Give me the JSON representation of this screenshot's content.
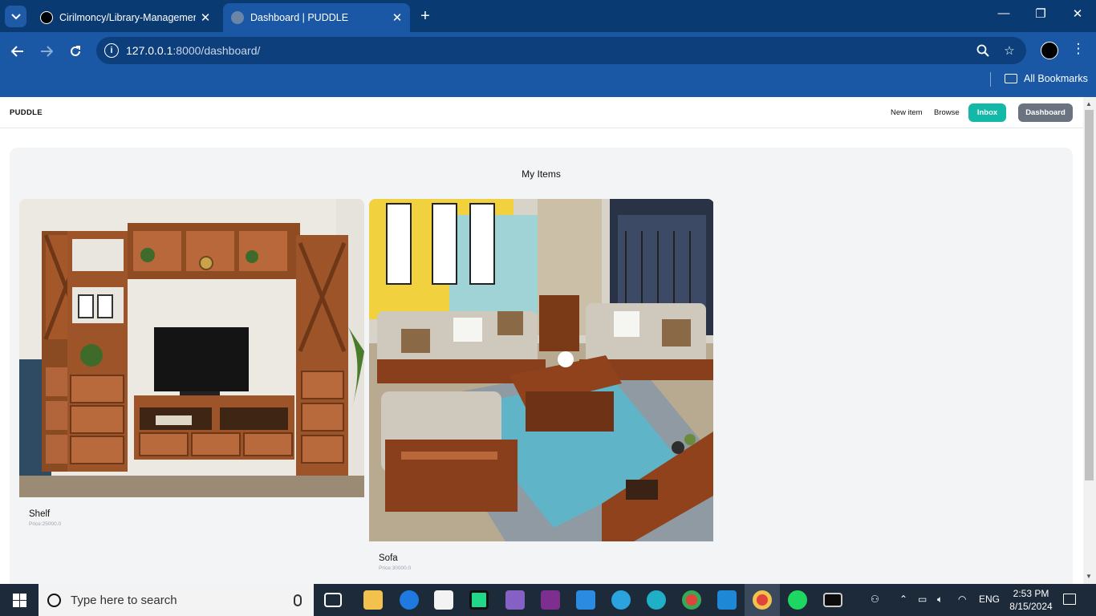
{
  "browser": {
    "tabs": [
      {
        "title": "Cirilmoncy/Library-Management",
        "active": false
      },
      {
        "title": "Dashboard | PUDDLE",
        "active": true
      }
    ],
    "new_tab": "+",
    "url_host": "127.0.0.1",
    "url_rest": ":8000/dashboard/",
    "bookmarks_label": "All Bookmarks",
    "window_controls": {
      "minimize": "—",
      "restore": "❐",
      "close": "✕"
    }
  },
  "site": {
    "brand": "PUDDLE",
    "nav": {
      "new_item": "New item",
      "browse": "Browse",
      "inbox": "Inbox",
      "dashboard": "Dashboard"
    },
    "section_title": "My Items",
    "items": [
      {
        "name": "Shelf",
        "price": "Price:25000.0"
      },
      {
        "name": "Sofa",
        "price": "Price:30000.0"
      }
    ]
  },
  "taskbar": {
    "search_placeholder": "Type here to search",
    "language": "ENG",
    "time": "2:53 PM",
    "date": "8/15/2024"
  },
  "colors": {
    "tabbar": "#0a3a72",
    "toolbar": "#1a58a6",
    "inbox_button": "#14b8a6",
    "dashboard_button": "#6b7280",
    "panel": "#f3f4f6"
  }
}
